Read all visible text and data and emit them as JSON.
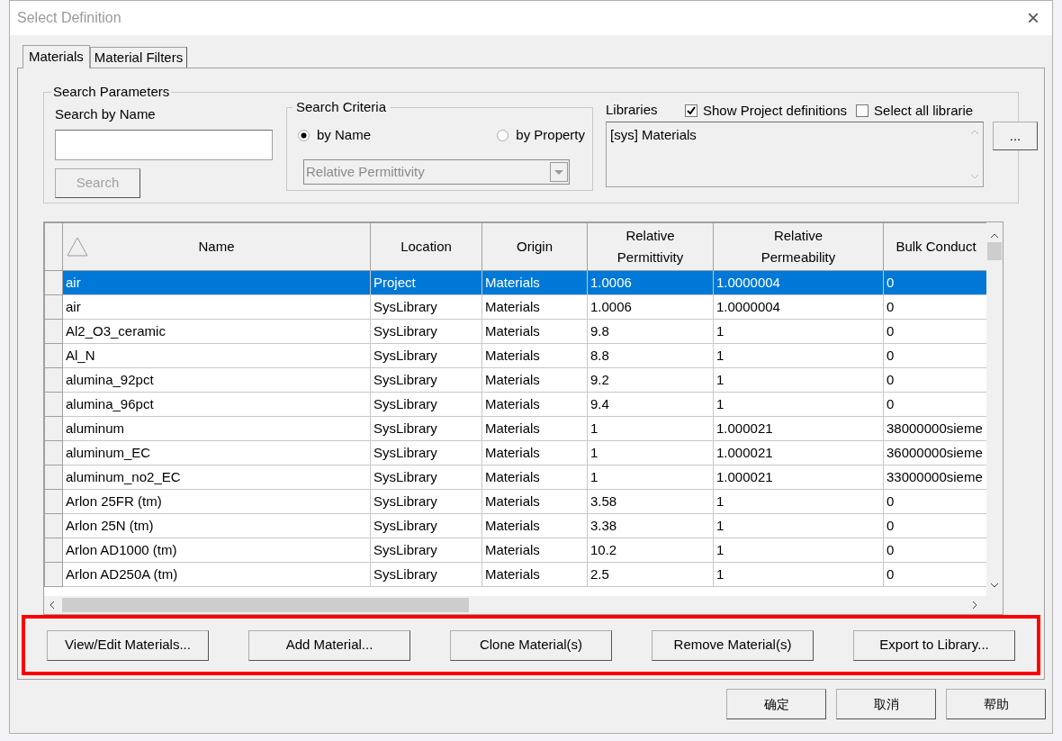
{
  "window": {
    "title": "Select Definition",
    "close": "×"
  },
  "tabs": [
    {
      "label": "Materials",
      "selected": true
    },
    {
      "label": "Material Filters",
      "selected": false
    }
  ],
  "search_parameters": {
    "title": "Search Parameters",
    "search_by_name": {
      "label": "Search by Name"
    },
    "search_button": {
      "label": "Search",
      "disabled": true
    },
    "criteria": {
      "title": "Search Criteria",
      "options": [
        {
          "label": "by Name",
          "selected": true
        },
        {
          "label": "by Property",
          "selected": false
        }
      ],
      "property_dropdown": {
        "value": "Relative Permittivity",
        "disabled": true
      }
    },
    "libraries": {
      "title": "Libraries",
      "checkboxes": [
        {
          "label": "Show Project definitions",
          "checked": true
        },
        {
          "label": "Select all librarie",
          "checked": false
        }
      ],
      "list": [
        "[sys] Materials"
      ],
      "browse_button": "..."
    }
  },
  "table": {
    "columns": [
      "Name",
      "Location",
      "Origin",
      "Relative Permittivity",
      "Relative Permeability",
      "Bulk Conduct"
    ],
    "rows": [
      {
        "selected": true,
        "cells": [
          "air",
          "Project",
          "Materials",
          "1.0006",
          "1.0000004",
          "0"
        ]
      },
      {
        "selected": false,
        "cells": [
          "air",
          "SysLibrary",
          "Materials",
          "1.0006",
          "1.0000004",
          "0"
        ]
      },
      {
        "selected": false,
        "cells": [
          "Al2_O3_ceramic",
          "SysLibrary",
          "Materials",
          "9.8",
          "1",
          "0"
        ]
      },
      {
        "selected": false,
        "cells": [
          "Al_N",
          "SysLibrary",
          "Materials",
          "8.8",
          "1",
          "0"
        ]
      },
      {
        "selected": false,
        "cells": [
          "alumina_92pct",
          "SysLibrary",
          "Materials",
          "9.2",
          "1",
          "0"
        ]
      },
      {
        "selected": false,
        "cells": [
          "alumina_96pct",
          "SysLibrary",
          "Materials",
          "9.4",
          "1",
          "0"
        ]
      },
      {
        "selected": false,
        "cells": [
          "aluminum",
          "SysLibrary",
          "Materials",
          "1",
          "1.000021",
          "38000000sieme"
        ]
      },
      {
        "selected": false,
        "cells": [
          "aluminum_EC",
          "SysLibrary",
          "Materials",
          "1",
          "1.000021",
          "36000000sieme"
        ]
      },
      {
        "selected": false,
        "cells": [
          "aluminum_no2_EC",
          "SysLibrary",
          "Materials",
          "1",
          "1.000021",
          "33000000sieme"
        ]
      },
      {
        "selected": false,
        "cells": [
          "Arlon 25FR (tm)",
          "SysLibrary",
          "Materials",
          "3.58",
          "1",
          "0"
        ]
      },
      {
        "selected": false,
        "cells": [
          "Arlon 25N (tm)",
          "SysLibrary",
          "Materials",
          "3.38",
          "1",
          "0"
        ]
      },
      {
        "selected": false,
        "cells": [
          "Arlon AD1000 (tm)",
          "SysLibrary",
          "Materials",
          "10.2",
          "1",
          "0"
        ]
      },
      {
        "selected": false,
        "cells": [
          "Arlon AD250A (tm)",
          "SysLibrary",
          "Materials",
          "2.5",
          "1",
          "0"
        ]
      }
    ]
  },
  "material_actions": {
    "highlighted": true,
    "buttons": [
      "View/Edit Materials...",
      "Add Material...",
      "Clone Material(s)",
      "Remove Material(s)",
      "Export to Library..."
    ]
  },
  "dialog_buttons": [
    "确定",
    "取消",
    "帮助"
  ]
}
